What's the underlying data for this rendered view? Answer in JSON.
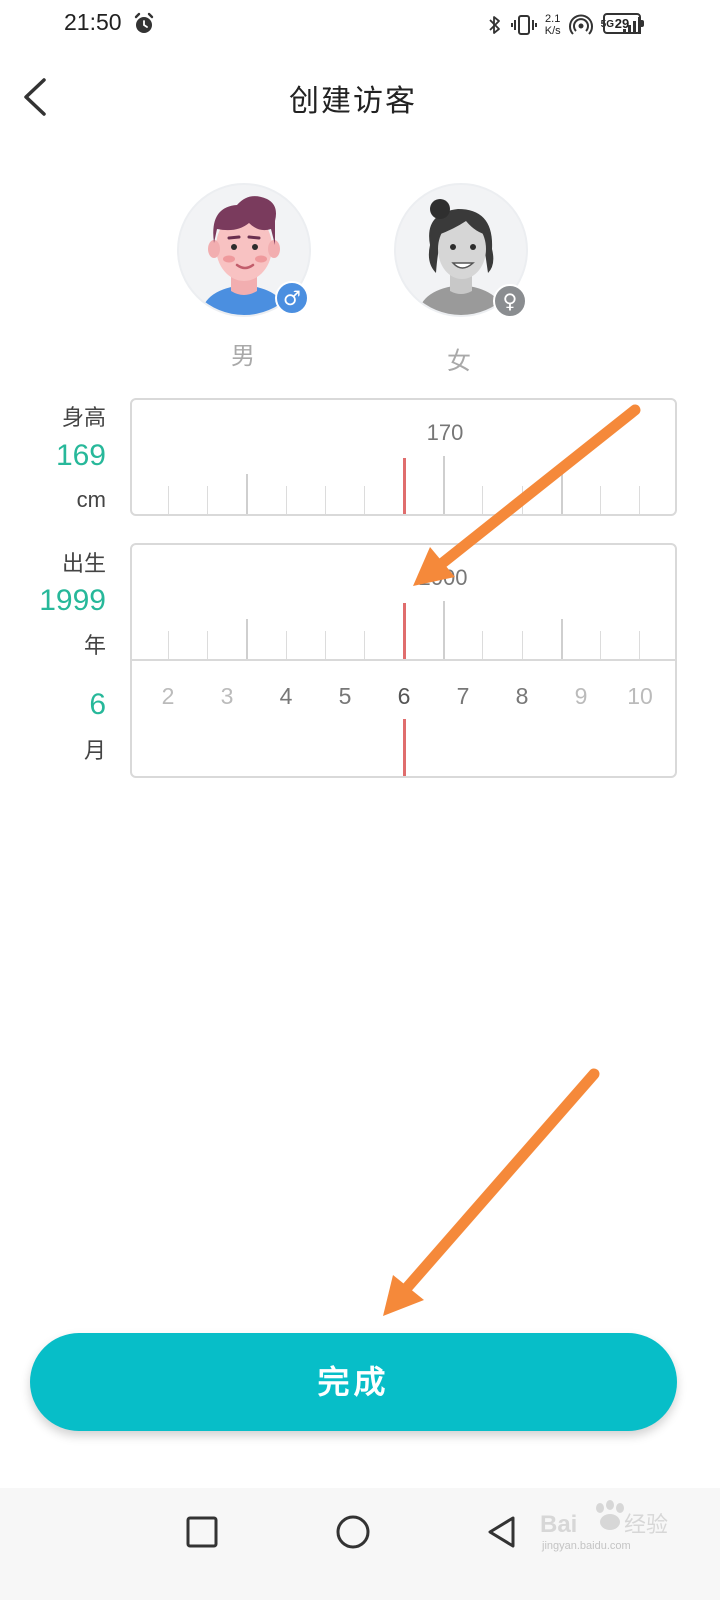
{
  "status_bar": {
    "time": "21:50",
    "speed_value": "2.1",
    "speed_unit": "K/s",
    "network": "5G",
    "battery": "29",
    "icons": [
      "alarm-icon",
      "bluetooth-icon",
      "vibrate-icon",
      "hotspot-icon",
      "signal-icon",
      "battery-icon"
    ]
  },
  "header": {
    "title": "创建访客",
    "back_icon": "chevron-left-icon"
  },
  "gender": {
    "male_label": "男",
    "female_label": "女",
    "male_symbol": "♂",
    "female_symbol": "♀",
    "selected": "male"
  },
  "height": {
    "label": "身高",
    "value": "169",
    "unit": "cm",
    "ruler_label": "170"
  },
  "birth": {
    "label": "出生",
    "year_value": "1999",
    "year_unit": "年",
    "year_ruler_label": "2000",
    "month_value": "6",
    "month_unit": "月",
    "month_scale": [
      "2",
      "3",
      "4",
      "5",
      "6",
      "7",
      "8",
      "9",
      "10"
    ],
    "selected_month": "6"
  },
  "actions": {
    "complete": "完成"
  },
  "navigation": {
    "icons": [
      "recents-square-icon",
      "home-circle-icon",
      "back-triangle-icon"
    ]
  },
  "watermark": {
    "text": "jingyan.baidu.com",
    "logo_text": "Baidu 经验"
  },
  "colors": {
    "accent": "#07bec8",
    "value_green": "#27b89a",
    "indicator_red": "#e06d6d",
    "annotation_orange": "#f5893a",
    "male_badge": "#4b8fe0",
    "female_badge": "#8a8d90"
  }
}
